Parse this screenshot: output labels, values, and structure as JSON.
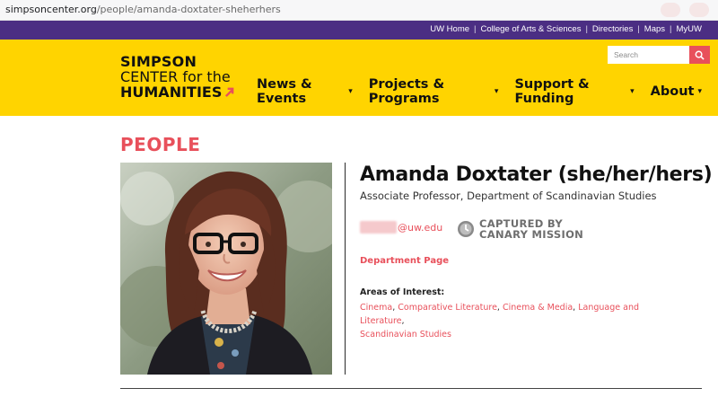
{
  "browser": {
    "url_host": "simpsoncenter.org",
    "url_path": "/people/amanda-doxtater-sheherhers"
  },
  "topbar": {
    "links": [
      "UW Home",
      "College of Arts & Sciences",
      "Directories",
      "Maps",
      "MyUW"
    ]
  },
  "header": {
    "logo": {
      "line1": "SIMPSON",
      "line2": "CENTER for the",
      "line3": "HUMANITIES"
    },
    "nav": [
      "News & Events",
      "Projects & Programs",
      "Support & Funding",
      "About"
    ],
    "search_placeholder": "Search"
  },
  "page": {
    "title": "PEOPLE"
  },
  "profile": {
    "name": "Amanda Doxtater (she/her/hers)",
    "position": "Associate Professor, Department of Scandinavian Studies",
    "email_domain": "@uw.edu",
    "captured": {
      "line1": "CAPTURED BY",
      "line2": "CANARY MISSION"
    },
    "department_link": "Department Page",
    "areas_label": "Areas of Interest:",
    "areas": [
      "Cinema",
      "Comparative Literature",
      "Cinema & Media",
      "Language and Literature",
      "Scandinavian Studies"
    ]
  },
  "colors": {
    "purple": "#4b2e83",
    "yellow": "#ffd400",
    "accent": "#e8505b"
  }
}
